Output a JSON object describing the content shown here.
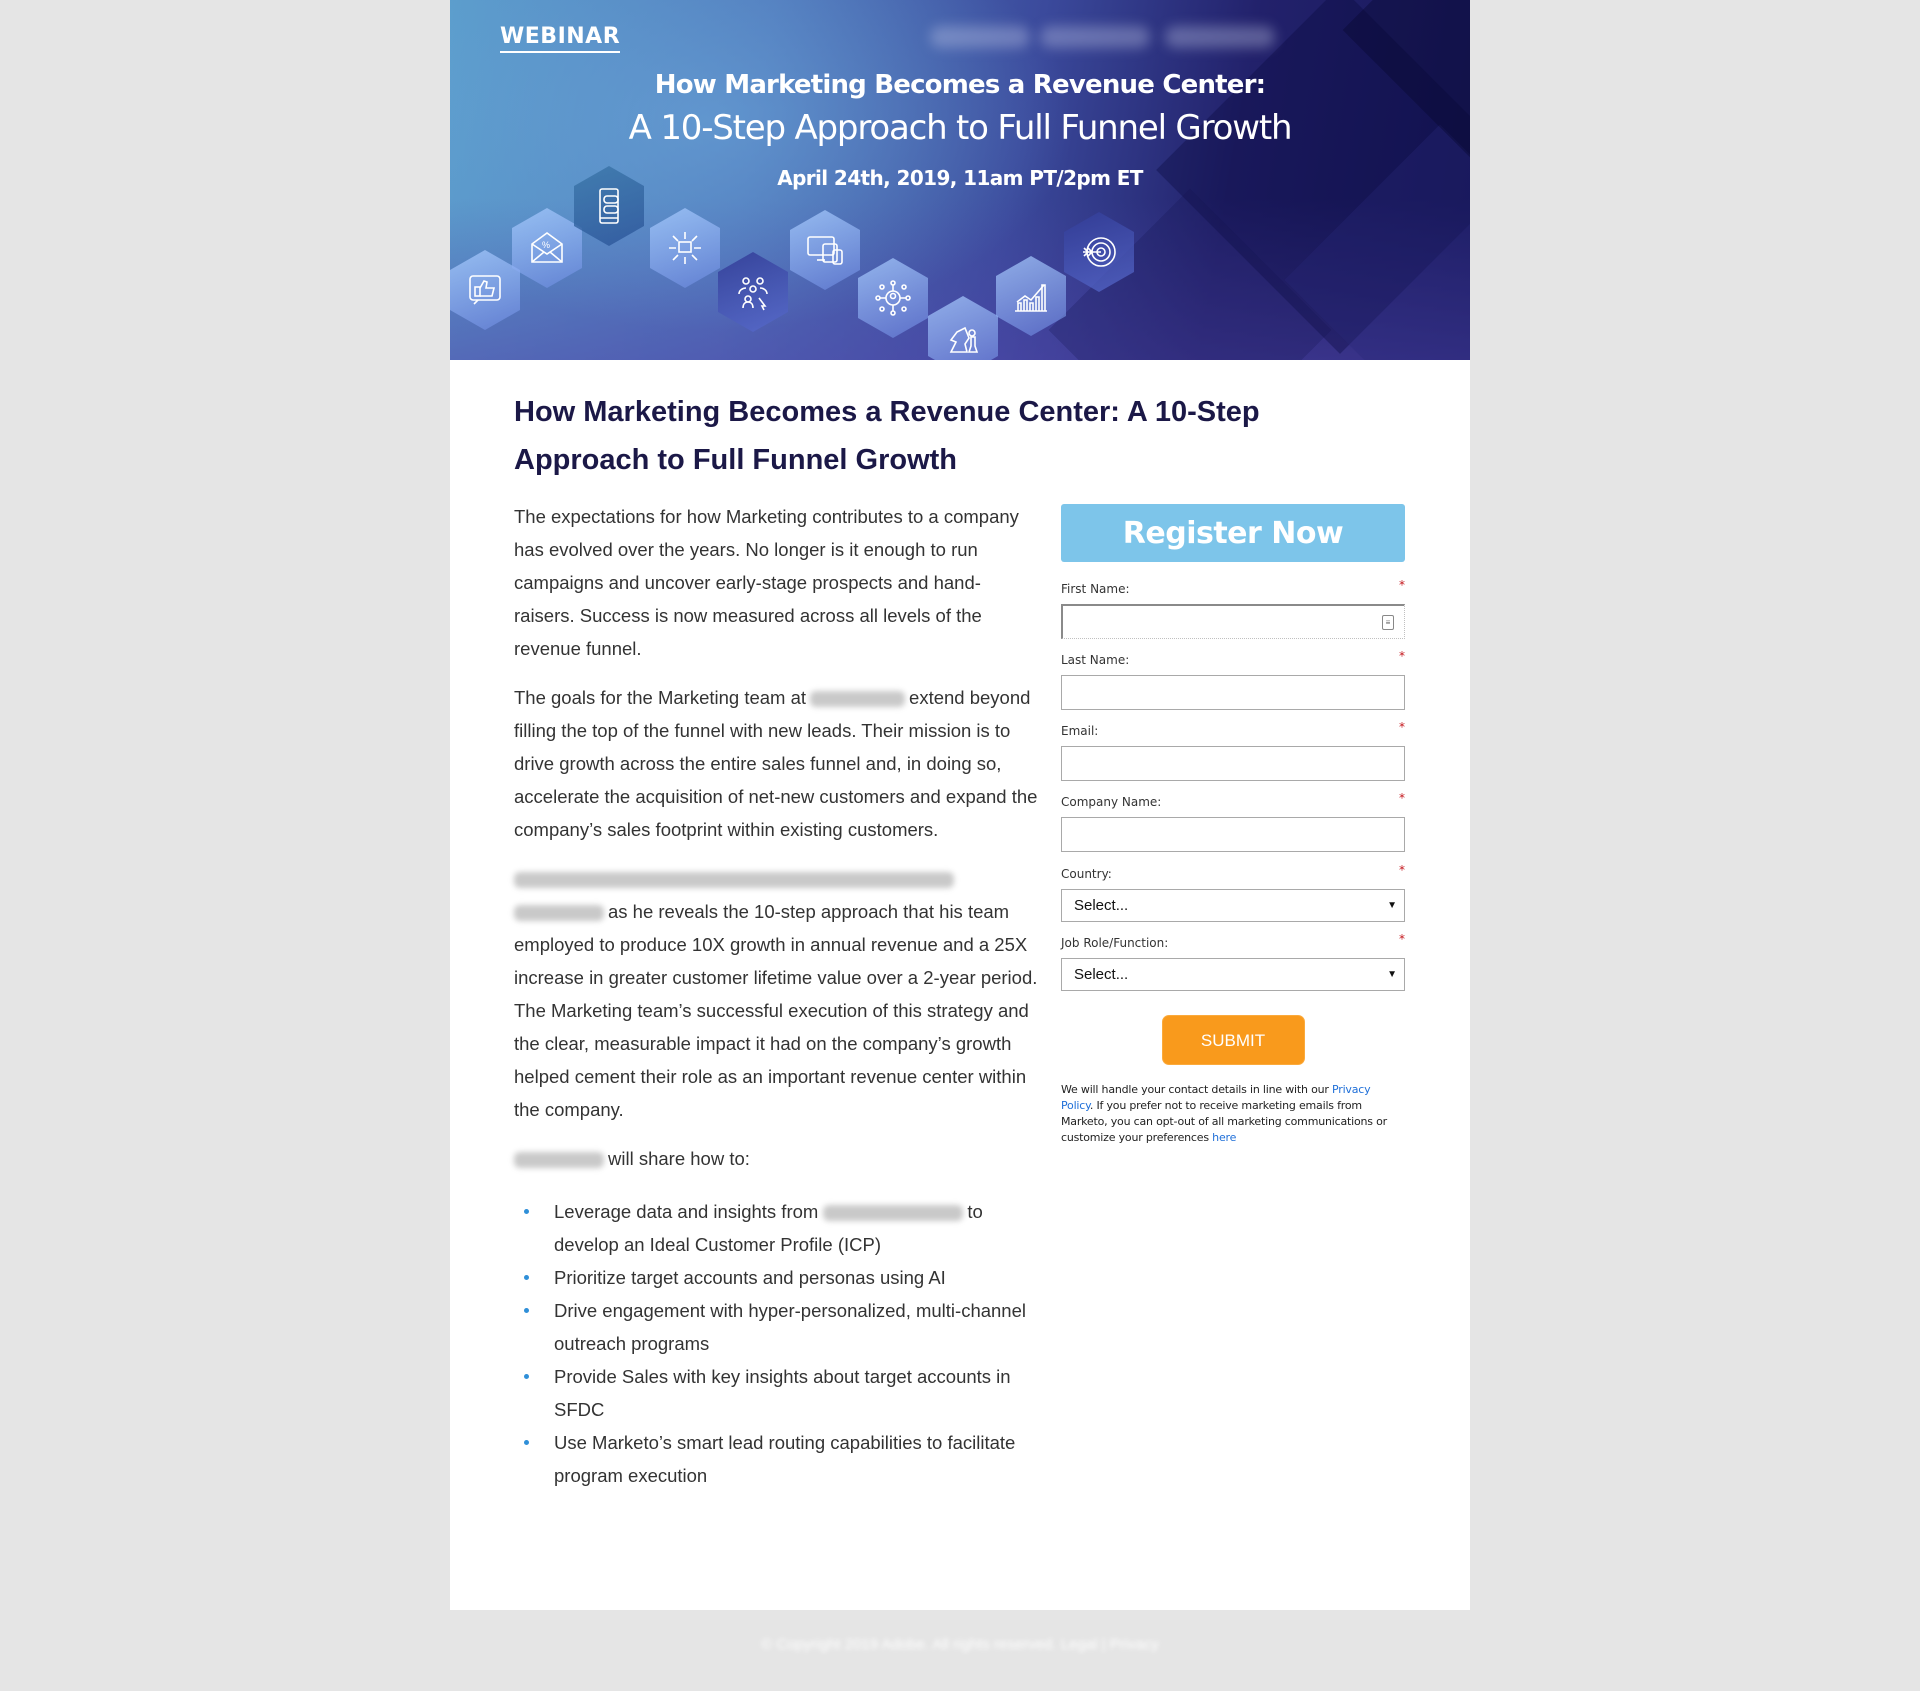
{
  "banner": {
    "tag": "WEBINAR",
    "title_line1": "How Marketing Becomes a Revenue Center:",
    "title_line2": "A 10-Step Approach to Full Funnel Growth",
    "date": "April 24th, 2019, 11am PT/2pm ET",
    "hex_icons": [
      "thumbs-up-chat-icon",
      "email-discount-icon",
      "mobile-chat-icon",
      "broadcast-message-icon",
      "audience-select-icon",
      "multi-device-icon",
      "network-person-icon",
      "chess-strategy-icon",
      "growth-chart-icon",
      "target-arrow-icon"
    ]
  },
  "main": {
    "title": "How Marketing Becomes a Revenue Center: A 10-Step Approach to Full Funnel Growth",
    "paragraph1": "The expectations for how Marketing contributes to a company has evolved over the years. No longer is it enough to run campaigns and uncover early-stage prospects and hand-raisers. Success is now measured across all levels of the revenue funnel.",
    "paragraph2_before": "The goals for the Marketing team at",
    "paragraph2_after": "extend beyond filling the top of the funnel with new leads. Their mission is to drive growth across the entire sales funnel and, in doing so, accelerate the acquisition of net-new customers and expand the company’s sales footprint within existing customers.",
    "paragraph3_after": "as he reveals the 10-step approach that his team employed to produce 10X growth in annual revenue and a 25X increase in greater customer lifetime value over a 2-year period. The Marketing team’s successful execution of this strategy and the clear, measurable impact it had on the company’s growth helped cement their role as an important revenue center within the company.",
    "paragraph4_after": "will share how to:",
    "bullets": [
      {
        "before": "Leverage data and insights from",
        "after": "to develop an Ideal Customer Profile (ICP)"
      },
      {
        "before": "Prioritize target accounts and personas using AI",
        "after": ""
      },
      {
        "before": "Drive engagement with hyper-personalized, multi-channel outreach programs",
        "after": ""
      },
      {
        "before": "Provide Sales with key insights about target accounts in SFDC",
        "after": ""
      },
      {
        "before": "Use Marketo’s smart lead routing capabilities to facilitate program execution",
        "after": ""
      }
    ]
  },
  "form": {
    "heading": "Register Now",
    "required_marker": "*",
    "fields": [
      {
        "label": "First Name:",
        "value": ""
      },
      {
        "label": "Last Name:",
        "value": ""
      },
      {
        "label": "Email:",
        "value": ""
      },
      {
        "label": "Company Name:",
        "value": ""
      }
    ],
    "selects": [
      {
        "label": "Country:",
        "selected": "Select..."
      },
      {
        "label": "Job Role/Function:",
        "selected": "Select..."
      }
    ],
    "submit_label": "SUBMIT",
    "disclaimer_part1": "We will handle your contact details in line with our",
    "privacy_link": "Privacy Policy",
    "disclaimer_part2": ". If you prefer not to receive marketing emails from Marketo, you can opt-out of all marketing communications or customize your preferences",
    "here_link": "here"
  },
  "colors": {
    "title": "#1b1847",
    "register_bg": "#7dc5ea",
    "submit_bg": "#f99a1c",
    "link": "#1f6fd8",
    "bullet": "#2f8fd8",
    "required": "#c4161c",
    "page_bg": "#e5e5e5"
  }
}
